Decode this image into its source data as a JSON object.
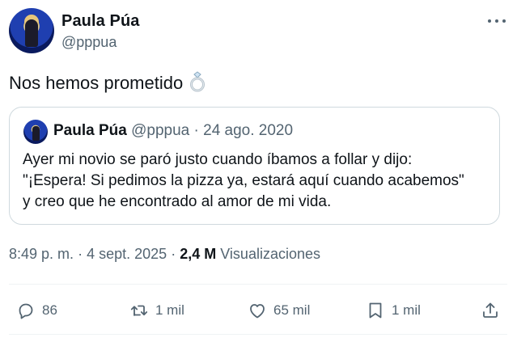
{
  "tweet": {
    "author_name": "Paula Púa",
    "author_handle": "@pppua",
    "text": "Nos hemos prometido",
    "emoji_icon": "ring-icon"
  },
  "quote": {
    "author_name": "Paula Púa",
    "author_handle": "@pppua",
    "separator": "·",
    "date": "24 ago. 2020",
    "lines": [
      "Ayer mi novio se paró justo cuando íbamos a follar y dijo:",
      "\"¡Espera! Si pedimos la pizza ya, estará aquí cuando acabemos\"",
      "y creo que he encontrado al amor de mi vida."
    ]
  },
  "meta": {
    "time": "8:49 p. m.",
    "separator": "·",
    "date": "4 sept. 2025",
    "separator2": "·",
    "views_count": "2,4 M",
    "views_label": "Visualizaciones"
  },
  "actions": {
    "replies": "86",
    "reposts": "1 mil",
    "likes": "65 mil",
    "bookmarks": "1 mil"
  },
  "colors": {
    "text": "#0f1419",
    "muted": "#536471",
    "border": "#cfd9de",
    "divider": "#eff3f4"
  }
}
